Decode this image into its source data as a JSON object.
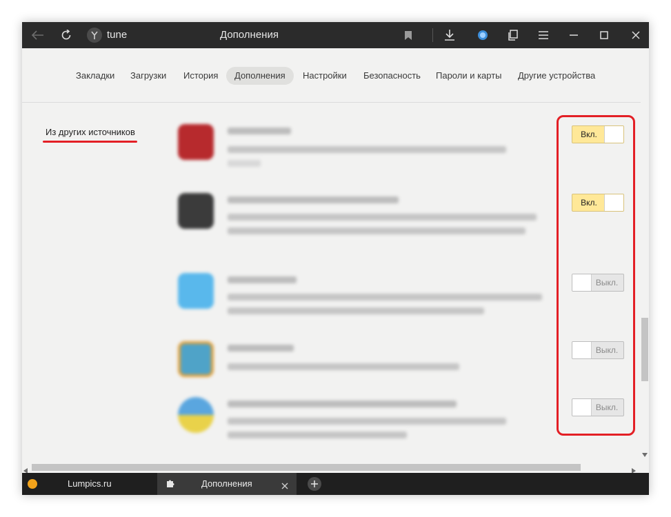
{
  "titlebar": {
    "url": "tune",
    "title": "Дополнения"
  },
  "nav": {
    "items": [
      "Закладки",
      "Загрузки",
      "История",
      "Дополнения",
      "Настройки",
      "Безопасность",
      "Пароли и карты",
      "Другие устройства"
    ],
    "active": "Дополнения"
  },
  "section": {
    "label": "Из других источников"
  },
  "extensions": [
    {
      "toggle_label": "Вкл.",
      "state": "on"
    },
    {
      "toggle_label": "Вкл.",
      "state": "on"
    },
    {
      "toggle_label": "Выкл.",
      "state": "off"
    },
    {
      "toggle_label": "Выкл.",
      "state": "off"
    },
    {
      "toggle_label": "Выкл.",
      "state": "off"
    }
  ],
  "tabs": [
    {
      "label": "Lumpics.ru",
      "icon": "orange-dot-icon"
    },
    {
      "label": "Дополнения",
      "icon": "puzzle-icon"
    }
  ],
  "colors": {
    "highlight_red": "#e31f25",
    "toggle_on": "#ffe898",
    "titlebar_bg": "#2b2b2b"
  }
}
